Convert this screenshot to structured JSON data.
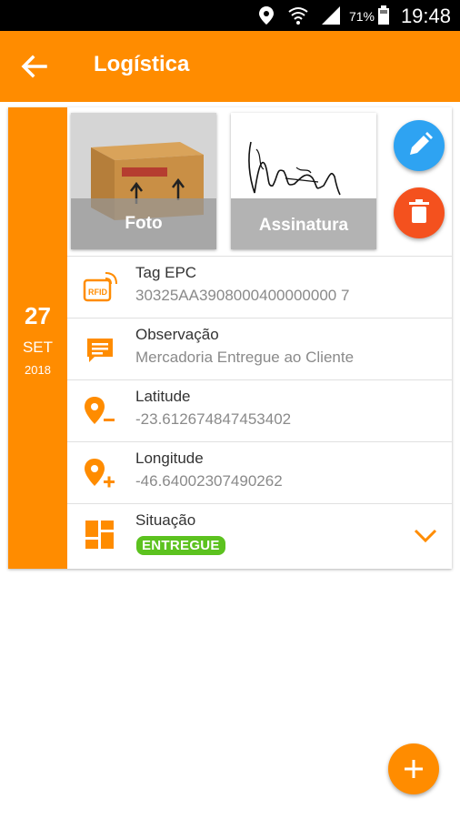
{
  "status_bar": {
    "battery_percent": "71%",
    "time": "19:48"
  },
  "app_bar": {
    "title": "Logística",
    "back_icon": "arrow-back-icon"
  },
  "date": {
    "day": "27",
    "month": "SET",
    "year": "2018"
  },
  "attachments": [
    {
      "label": "Foto"
    },
    {
      "label": "Assinatura"
    }
  ],
  "actions": {
    "edit_icon": "pencil-icon",
    "edit_color": "#2ea3f2",
    "delete_icon": "trash-icon",
    "delete_color": "#f4511e"
  },
  "fields": [
    {
      "label": "Tag EPC",
      "value": "30325AA3908000400000000 7",
      "icon": "rfid-icon"
    },
    {
      "label": "Observação",
      "value": "Mercadoria Entregue ao Cliente",
      "icon": "comment-icon"
    },
    {
      "label": "Latitude",
      "value": "-23.612674847453402",
      "icon": "location-minus-icon"
    },
    {
      "label": "Longitude",
      "value": "-46.64002307490262",
      "icon": "location-plus-icon"
    }
  ],
  "status": {
    "label": "Situação",
    "value": "ENTREGUE",
    "icon": "dashboard-icon",
    "badge_color": "#5cc21f"
  },
  "fab_add": {
    "icon": "plus-icon"
  },
  "colors": {
    "primary": "#ff8c00",
    "white": "#ffffff"
  }
}
